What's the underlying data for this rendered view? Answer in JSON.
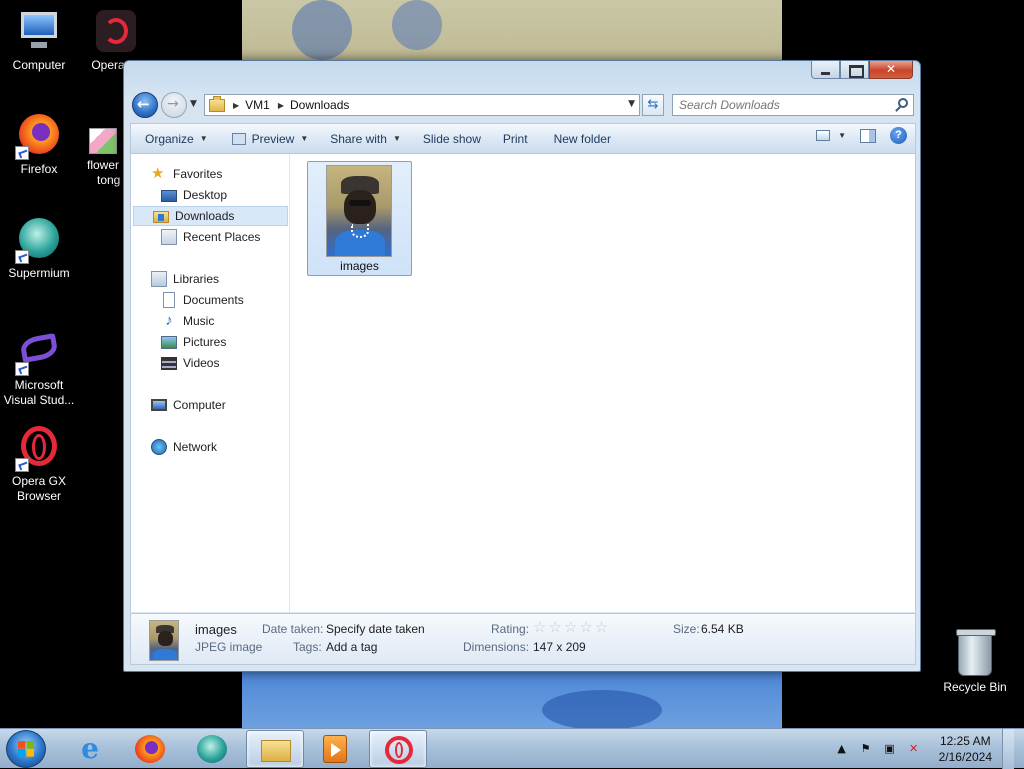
{
  "desktop": {
    "icons": [
      {
        "label": "Computer",
        "icon": "computer-icon"
      },
      {
        "label": "Opera_G",
        "icon": "opera-gx-icon"
      },
      {
        "label": "Firefox",
        "icon": "firefox-icon"
      },
      {
        "label": "flower",
        "label2": "tong",
        "icon": "image-file-icon"
      },
      {
        "label": "Supermium",
        "icon": "supermium-icon"
      },
      {
        "label": "Microsoft",
        "label2": "Visual Stud...",
        "icon": "visual-studio-icon"
      },
      {
        "label": "Opera GX",
        "label2": "Browser",
        "icon": "opera-gx-icon"
      }
    ],
    "recycle_bin": "Recycle Bin"
  },
  "explorer": {
    "address": {
      "root": "VM1",
      "current": "Downloads"
    },
    "search_placeholder": "Search Downloads",
    "toolbar": {
      "organize": "Organize",
      "preview": "Preview",
      "share_with": "Share with",
      "slide_show": "Slide show",
      "print": "Print",
      "new_folder": "New folder"
    },
    "nav": {
      "favorites": "Favorites",
      "desktop": "Desktop",
      "downloads": "Downloads",
      "recent_places": "Recent Places",
      "libraries": "Libraries",
      "documents": "Documents",
      "music": "Music",
      "pictures": "Pictures",
      "videos": "Videos",
      "computer": "Computer",
      "network": "Network"
    },
    "files": [
      {
        "name": "images",
        "selected": true
      }
    ],
    "details": {
      "name": "images",
      "type": "JPEG image",
      "date_taken_label": "Date taken:",
      "date_taken_value": "Specify date taken",
      "tags_label": "Tags:",
      "tags_value": "Add a tag",
      "rating_label": "Rating:",
      "rating": 0,
      "rating_max": 5,
      "dimensions_label": "Dimensions:",
      "dimensions_value": "147 x 209",
      "size_label": "Size:",
      "size_value": "6.54 KB"
    }
  },
  "taskbar": {
    "apps": [
      "internet-explorer-icon",
      "firefox-icon",
      "supermium-icon",
      "file-explorer-icon",
      "media-player-icon",
      "opera-gx-icon"
    ],
    "active_app": "file-explorer-icon",
    "clock": {
      "time": "12:25 AM",
      "date": "2/16/2024"
    }
  },
  "colors": {
    "selection": "#cfe2f8",
    "accent": "#2b76c9",
    "close": "#c8452a"
  }
}
